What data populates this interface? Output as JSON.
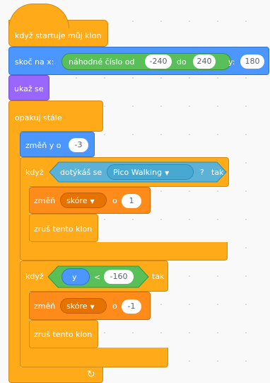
{
  "blocks": {
    "hat": "když startuje můj klon",
    "goto": {
      "prefix": "skoč na x:",
      "random_label": "náhodné číslo od",
      "from": "-240",
      "to_label": "do",
      "to": "240",
      "y_label": "y:",
      "y": "180"
    },
    "show": "ukaž se",
    "forever": "opakuj stále",
    "change_y": {
      "label": "změň y o",
      "value": "-3"
    },
    "if1": {
      "if_label": "když",
      "touch_label": "dotýkáš se",
      "target": "Pico Walking",
      "q": "?",
      "then": "tak"
    },
    "change1": {
      "label": "změň",
      "var": "skóre",
      "by": "o",
      "value": "1"
    },
    "delete1": "zruš tento klon",
    "if2": {
      "if_label": "když",
      "var": "y",
      "op": "<",
      "value": "-160",
      "then": "tak"
    },
    "change2": {
      "label": "změň",
      "var": "skóre",
      "by": "o",
      "value": "-1"
    },
    "delete2": "zruš tento klon"
  },
  "colors": {
    "control": "#ffab19",
    "motion": "#4c97ff",
    "looks": "#9966ff",
    "operators": "#59c059",
    "sensing": "#5cb1d6",
    "variables": "#ff8c1a"
  },
  "icons": {
    "loop": "loop-arrow-icon",
    "dropdown": "dropdown-arrow-icon"
  }
}
